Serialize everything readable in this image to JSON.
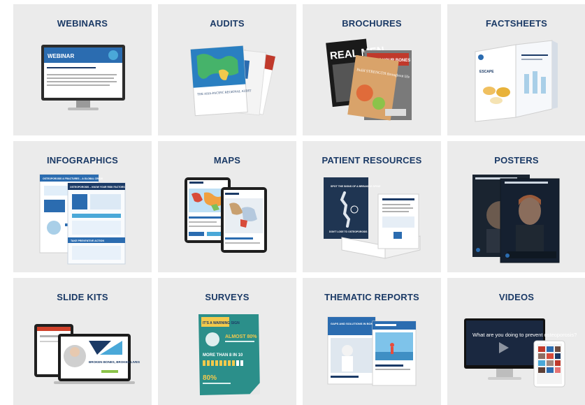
{
  "tiles": [
    {
      "title": "WEBINARS",
      "icon": "webinar-laptop-icon",
      "text": [
        "WEBINAR"
      ]
    },
    {
      "title": "AUDITS",
      "icon": "audit-report-icon",
      "text": [
        "THE ASIA-PACIFIC REGIONAL AUDIT"
      ]
    },
    {
      "title": "BROCHURES",
      "icon": "brochure-stack-icon",
      "text": [
        "REAL MEN",
        "LOVE YOUR BONES",
        "Build STRENGTH throughout life"
      ]
    },
    {
      "title": "FACTSHEETS",
      "icon": "factsheet-folded-icon",
      "text": [
        "ESCAPE"
      ]
    },
    {
      "title": "INFOGRAPHICS",
      "icon": "infographic-sheets-icon",
      "text": [
        "OSTEOPOROSIS & FRACTURES – A GLOBAL CRISIS",
        "OSTEOPOROSIS – KNOW YOUR RISK FACTORS",
        "TAKE PREVENTIVE ACTION"
      ]
    },
    {
      "title": "MAPS",
      "icon": "map-tablets-icon",
      "text": []
    },
    {
      "title": "PATIENT RESOURCES",
      "icon": "patient-booklet-icon",
      "text": [
        "SPOT THE SIGNS OF A BREAKING SPINE",
        "DON'T LOSE TO OSTEOPOROSIS"
      ]
    },
    {
      "title": "POSTERS",
      "icon": "poster-pair-icon",
      "text": []
    },
    {
      "title": "SLIDE KITS",
      "icon": "slidekit-devices-icon",
      "text": [
        "BROKEN BONES, BROKEN LIVES"
      ]
    },
    {
      "title": "SURVEYS",
      "icon": "survey-poster-icon",
      "text": [
        "IT'S A WARNING SIGN",
        "ALMOST 80%",
        "MORE THAN 8 IN 10",
        "80%"
      ]
    },
    {
      "title": "THEMATIC REPORTS",
      "icon": "thematic-report-icon",
      "text": [
        "GAPS AND SOLUTIONS IN BONE HEALTH"
      ]
    },
    {
      "title": "VIDEOS",
      "icon": "video-monitor-icon",
      "text": [
        "What are you doing to prevent osteoporosis?"
      ]
    }
  ],
  "colors": {
    "tile_bg": "#ebebeb",
    "title": "#1b3a66",
    "brand_blue": "#2b6cb0",
    "brand_red": "#c0392b"
  }
}
